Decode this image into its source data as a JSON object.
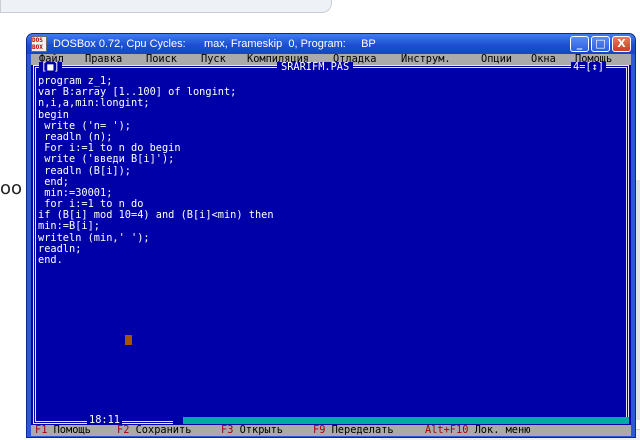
{
  "background": {
    "left_text": "oo"
  },
  "window": {
    "icon_label": "DOS BOX",
    "title": "DOSBox 0.72, Cpu Cycles:      max, Frameskip  0, Program:     BP",
    "buttons": {
      "minimize": "_",
      "maximize": "□",
      "close": "X"
    }
  },
  "menu": {
    "items": [
      "Файл",
      "Правка",
      "Поиск",
      "Пуск",
      "Компиляция",
      "Отладка",
      "Инструм.",
      "Опции",
      "Окна",
      "Помощь"
    ]
  },
  "editor": {
    "filename": "SRARIFM.PAS",
    "left_mark": "[■]",
    "right_mark": "4=[↕]",
    "code_lines": [
      "program z_1;",
      "var B:array [1..100] of longint;",
      "n,i,a,min:longint;",
      "begin",
      " write ('n= ');",
      " readln (n);",
      " For i:=1 to n do begin",
      " write ('введи B[i]');",
      " readln (B[i]);",
      " end;",
      " min:=30001;",
      " for i:=1 to n do",
      "if (B[i] mod 10=4) and (B[i]<min) then",
      "min:=B[i];",
      "writeln (min,' ');",
      "readln;",
      "end."
    ],
    "cursor_position": "18:11"
  },
  "hotkeys": [
    {
      "key": "F1",
      "label": "Помощь"
    },
    {
      "key": "F2",
      "label": "Сохранить"
    },
    {
      "key": "F3",
      "label": "Открыть"
    },
    {
      "key": "F9",
      "label": "Переделать"
    },
    {
      "key": "Alt+F10",
      "label": "Лок. меню"
    }
  ],
  "colors": {
    "dos_blue": "#0000a8",
    "dos_gray": "#aaaaaa",
    "hotkey_red": "#a80000",
    "cursor": "#a85400"
  }
}
